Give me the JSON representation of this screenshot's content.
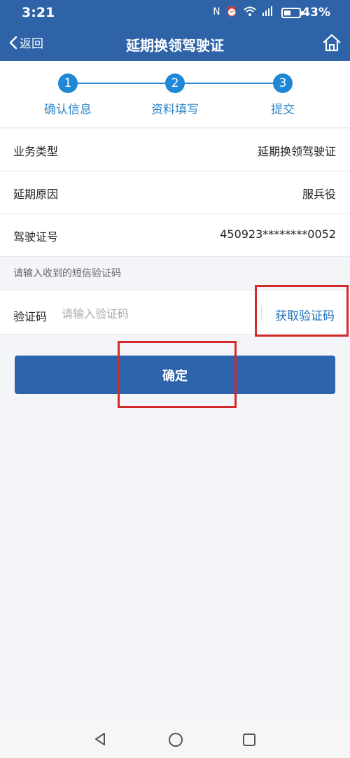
{
  "status_bar": {
    "time": "3:21",
    "icons": [
      "nfc-icon",
      "alarm-icon",
      "wifi-icon",
      "signal-icon",
      "battery-icon"
    ],
    "battery_percent": 43,
    "battery_text": "43%"
  },
  "nav": {
    "back_label": "返回",
    "title": "延期换领驾驶证",
    "home_icon": "home-icon"
  },
  "steps": [
    {
      "number": "1",
      "label": "确认信息"
    },
    {
      "number": "2",
      "label": "资料填写"
    },
    {
      "number": "3",
      "label": "提交"
    }
  ],
  "info_rows": [
    {
      "label": "业务类型",
      "value": "延期换领驾驶证"
    },
    {
      "label": "延期原因",
      "value": "服兵役"
    },
    {
      "label": "驾驶证号",
      "value": "450923********0052"
    }
  ],
  "sms_hint": "请输入收到的短信验证码",
  "code_field": {
    "label": "验证码",
    "placeholder": "请输入验证码",
    "value": "",
    "get_code_label": "获取验证码"
  },
  "confirm_label": "确定",
  "colors": {
    "header": "#2e63a8",
    "step_accent": "#1e88d6",
    "button": "#2e64ab",
    "highlight": "#d32a2a"
  },
  "bottom_nav": [
    "back-triangle-icon",
    "home-circle-icon",
    "recents-square-icon"
  ]
}
